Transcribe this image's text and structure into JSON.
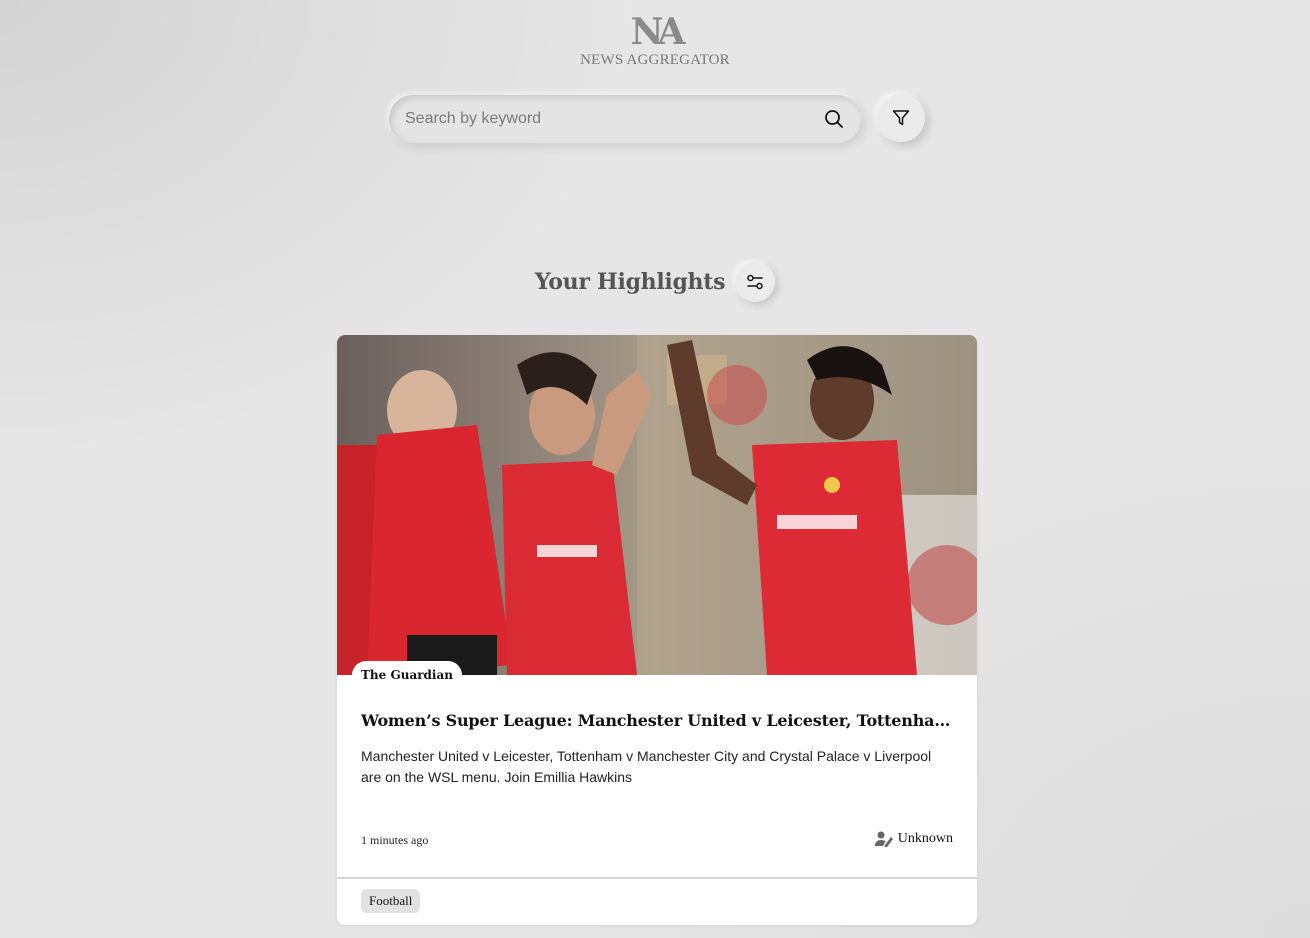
{
  "logo": {
    "mark": "NA",
    "text": "NEWS AGGREGATOR"
  },
  "search": {
    "placeholder": "Search by keyword",
    "value": ""
  },
  "highlights": {
    "title": "Your Highlights"
  },
  "article": {
    "source": "The Guardian",
    "title": "Women’s Super League: Manchester United v Leicester, Tottenham v…",
    "description": "Manchester United v Leicester, Tottenham v Manchester City and Crystal Palace v Liverpool are on the WSL menu. Join Emillia Hawkins",
    "time": "1 minutes ago",
    "author": "Unknown",
    "tags": [
      "Football"
    ]
  },
  "icons": {
    "search": "search-icon",
    "filter": "filter-icon",
    "settings": "sliders-icon",
    "author": "person-icon"
  }
}
